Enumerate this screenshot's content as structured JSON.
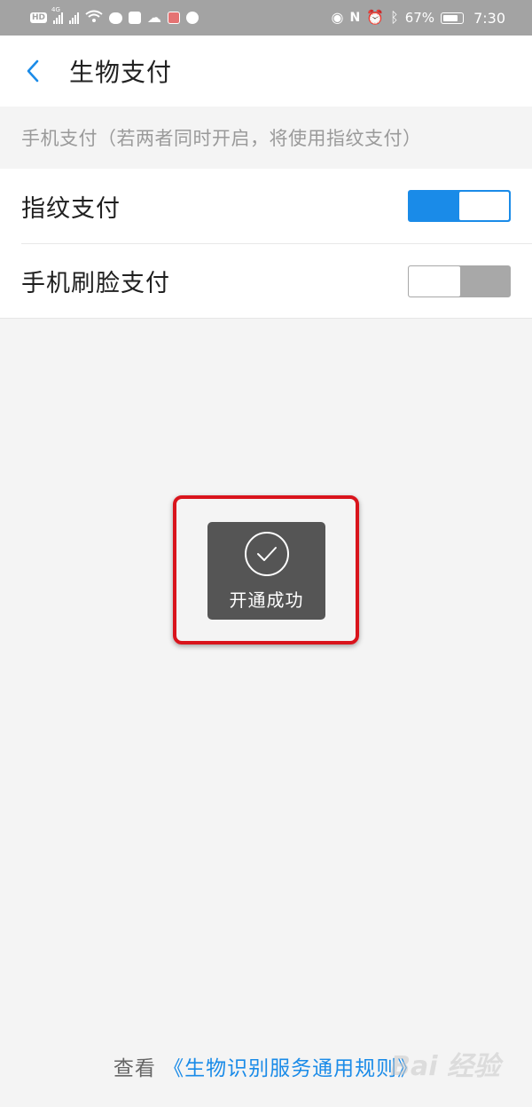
{
  "status_bar": {
    "time": "7:30",
    "battery": "67%",
    "network_label": "4G",
    "hd_badge": "HD",
    "icons": [
      "hd-icon",
      "signal-icon",
      "signal-icon",
      "wifi-icon",
      "chat-icon",
      "app-icon",
      "cloud-icon",
      "book-icon",
      "voice-icon",
      "eye-icon",
      "nfc-icon",
      "alarm-icon",
      "bluetooth-icon",
      "battery-icon"
    ]
  },
  "header": {
    "title": "生物支付",
    "back_icon": "chevron-left-icon"
  },
  "section": {
    "hint": "手机支付（若两者同时开启，将使用指纹支付）"
  },
  "settings": {
    "items": [
      {
        "label": "指纹支付",
        "enabled": true
      },
      {
        "label": "手机刷脸支付",
        "enabled": false
      }
    ]
  },
  "toast": {
    "message": "开通成功",
    "icon": "check-circle-icon"
  },
  "footer": {
    "prefix": "查看",
    "link": "《生物识别服务通用规则》"
  },
  "watermark": {
    "text": "Bai 经验"
  },
  "colors": {
    "accent": "#1a8be8",
    "highlight_border": "#d9141c",
    "toast_bg": "#555555",
    "status_bar_bg": "#a3a3a3"
  }
}
